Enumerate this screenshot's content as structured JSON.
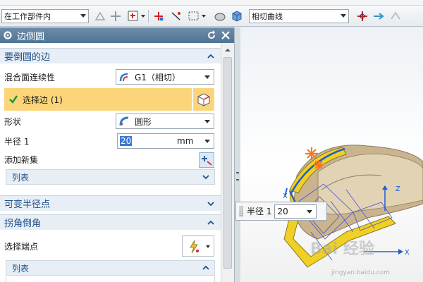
{
  "toolbar": {
    "filter_value": "在工作部件内",
    "curve_rule_value": "相切曲线"
  },
  "dialog": {
    "title": "边倒圆",
    "section_edges": "要倒圆的边",
    "blend_continuity_label": "混合面连续性",
    "blend_continuity_value": "G1（相切）",
    "select_edge_label": "选择边 (1)",
    "shape_label": "形状",
    "shape_value": "圆形",
    "radius_label": "半径 1",
    "radius_value": "20",
    "radius_unit": "mm",
    "add_set_label": "添加新集",
    "list_label_1": "列表",
    "section_variable": "可变半径点",
    "section_corner": "拐角倒角",
    "select_endpoint_label": "选择端点",
    "list_label_2": "列表"
  },
  "viewport": {
    "popup_label": "半径 1",
    "popup_value": "20",
    "axis_z": "Z",
    "axis_x": "X",
    "watermark": "Bai 经验",
    "watermark_sub": "jingyan.baidu.com"
  }
}
